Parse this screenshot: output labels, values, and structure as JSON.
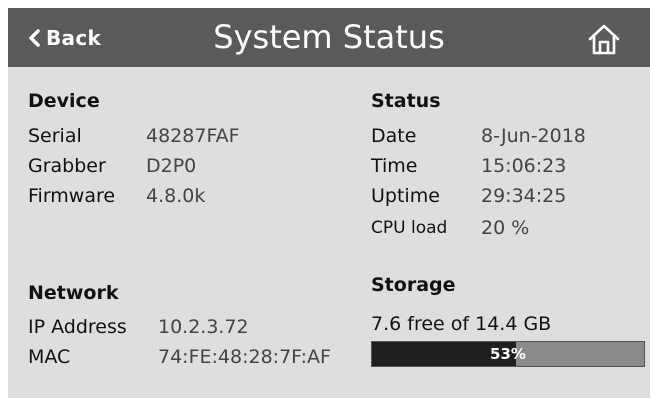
{
  "header": {
    "back_label": "Back",
    "title": "System Status",
    "home_icon": "home-icon",
    "back_icon": "chevron-left-icon",
    "bar_color": "#5a5a5a"
  },
  "device": {
    "title": "Device",
    "rows": [
      {
        "label": "Serial",
        "value": "48287FAF"
      },
      {
        "label": "Grabber",
        "value": "D2P0"
      },
      {
        "label": "Firmware",
        "value": "4.8.0k"
      }
    ]
  },
  "status": {
    "title": "Status",
    "rows": [
      {
        "label": "Date",
        "value": "8-Jun-2018"
      },
      {
        "label": "Time",
        "value": "15:06:23"
      },
      {
        "label": "Uptime",
        "value": "29:34:25"
      },
      {
        "label": "CPU load",
        "value": "20 %"
      }
    ]
  },
  "network": {
    "title": "Network",
    "rows": [
      {
        "label": "IP Address",
        "value": "10.2.3.72"
      },
      {
        "label": "MAC",
        "value": "74:FE:48:28:7F:AF"
      }
    ]
  },
  "storage": {
    "title": "Storage",
    "summary": "7.6 free of 14.4 GB",
    "used_percent": 53,
    "used_label": "53%"
  }
}
